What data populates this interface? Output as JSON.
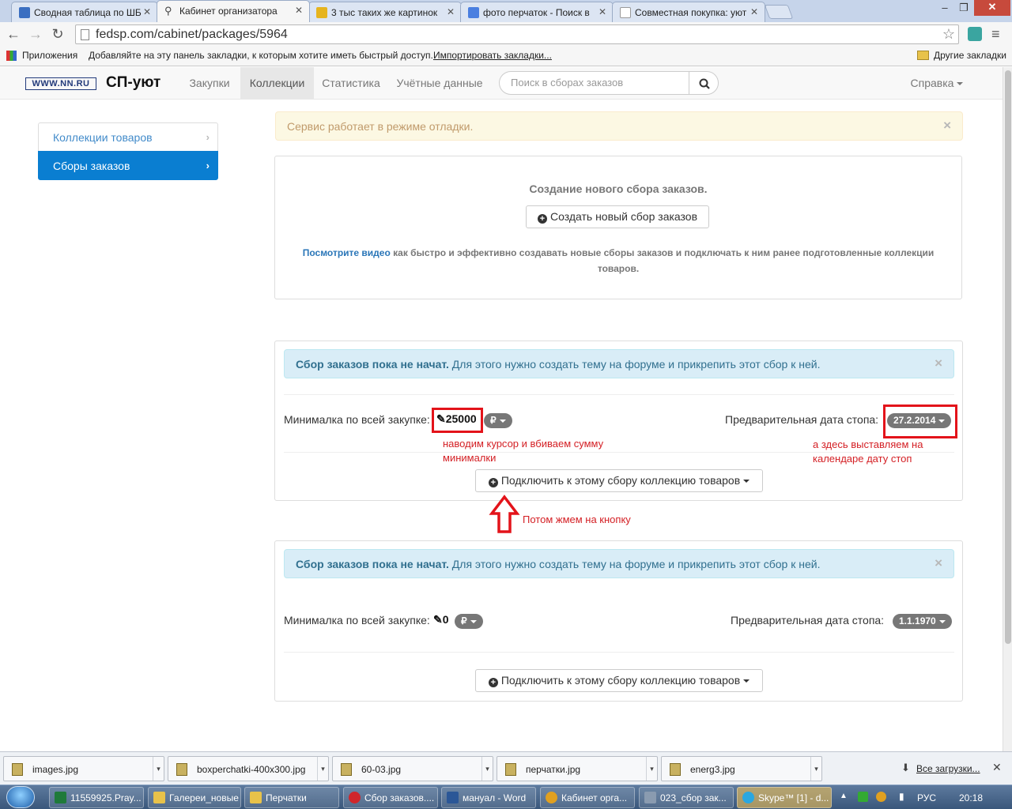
{
  "tabs": [
    {
      "label": "Сводная таблица по ШБ",
      "icon": "doc-icon",
      "color": "#3b6fc1",
      "active": false
    },
    {
      "label": "Кабинет организатора",
      "icon": "cart-icon",
      "color": "#555555",
      "active": true
    },
    {
      "label": "3 тыс таких же картинок",
      "icon": "image-icon",
      "color": "#e6b41e",
      "active": false
    },
    {
      "label": "фото перчаток - Поиск в",
      "icon": "google-icon",
      "color": "#4a7fe0",
      "active": false
    },
    {
      "label": "Совместная покупка: уют",
      "icon": "page-icon",
      "color": "#b0b0b0",
      "active": false
    }
  ],
  "browser": {
    "url": "fedsp.com/cabinet/packages/5964",
    "apps_label": "Приложения",
    "bookmarks_hint": "Добавляйте на эту панель закладки, к которым хотите иметь быстрый доступ.",
    "import_link": "Импортировать закладки...",
    "other_bookmarks": "Другие закладки"
  },
  "site": {
    "logo_text": "WWW.NN.RU",
    "brand": "СП-уют",
    "nav": [
      "Закупки",
      "Коллекции",
      "Статистика",
      "Учётные данные"
    ],
    "active_nav": 1,
    "search_placeholder": "Поиск в сборах заказов",
    "help": "Справка"
  },
  "sidebar": {
    "items": [
      {
        "label": "Коллекции товаров",
        "active": false
      },
      {
        "label": "Сборы заказов",
        "active": true
      }
    ]
  },
  "debug_alert": "Сервис работает в режиме отладки.",
  "create_panel": {
    "title": "Создание нового сбора заказов.",
    "button": "Создать новый сбор заказов",
    "video_link": "Посмотрите видео",
    "video_text": "как быстро и эффективно создавать новые сборы заказов и подключать к ним ранее подготовленные коллекции товаров."
  },
  "packages": [
    {
      "alert_bold": "Сбор заказов пока не начат.",
      "alert_text": "Для этого нужно создать тему на форуме и прикрепить этот сбор к ней.",
      "min_label": "Минималка по всей закупке:",
      "min_value": "25000",
      "currency": "₽",
      "date_label": "Предварительная дата стопа:",
      "date_value": "27.2.2014",
      "connect_button": "Подключить к этому сбору коллекцию товаров"
    },
    {
      "alert_bold": "Сбор заказов пока не начат.",
      "alert_text": "Для этого нужно создать тему на форуме и прикрепить этот сбор к ней.",
      "min_label": "Минималка по всей закупке:",
      "min_value": "0",
      "currency": "₽",
      "date_label": "Предварительная дата стопа:",
      "date_value": "1.1.1970",
      "connect_button": "Подключить к этому сбору коллекцию товаров"
    }
  ],
  "annotations": {
    "min_note_line1": "наводим курсор и вбиваем сумму",
    "min_note_line2": "минималки",
    "date_note_line1": "а здесь выставляем на",
    "date_note_line2": "календаре дату стоп",
    "button_note": "Потом жмем на кнопку",
    "highlight_color": "#e3131a"
  },
  "downloads": {
    "files": [
      "images.jpg",
      "boxperchatki-400x300.jpg",
      "60-03.jpg",
      "перчатки.jpg",
      "energ3.jpg"
    ],
    "all_link": "Все загрузки..."
  },
  "taskbar": {
    "items": [
      {
        "label": "11559925.Pray...",
        "color": "#1f7a3a"
      },
      {
        "label": "Галереи_новые",
        "color": "#e8c24a"
      },
      {
        "label": "Перчатки",
        "color": "#e8c24a"
      },
      {
        "label": "Сбор заказов....",
        "color": "#d0262b"
      },
      {
        "label": "мануал - Word",
        "color": "#2b5797"
      },
      {
        "label": "Кабинет орга...",
        "color": "#e0a020"
      },
      {
        "label": "023_сбор зак...",
        "color": "#8a9bb0"
      },
      {
        "label": "Skype™ [1] - d...",
        "color": "#2aa7e0"
      }
    ],
    "lang": "РУС",
    "time": "20:18"
  }
}
